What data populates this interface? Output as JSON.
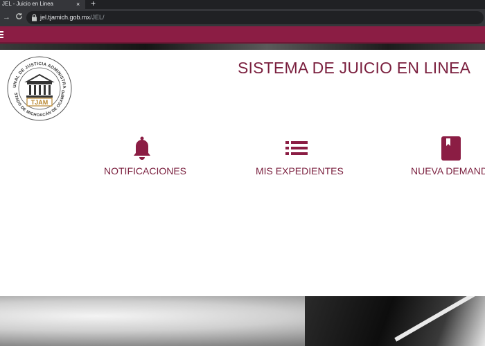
{
  "browser": {
    "tab_title": "JEL - Juicio en Linea",
    "tab_close": "×",
    "new_tab": "+",
    "back": "→",
    "reload": "C",
    "url_host": "jel.tjamich.gob.mx",
    "url_path": "/JEL/"
  },
  "logo": {
    "text_top": "TRIBUNAL DE JUSTICIA ADMINISTRATIVA",
    "text_bottom": "ESTADO DE MICHOACÁN DE OCAMPO",
    "abbr": "TJAM"
  },
  "page": {
    "title": "SISTEMA DE JUICIO EN LINEA"
  },
  "menu": [
    {
      "label": "NOTIFICACIONES",
      "icon": "bell-icon"
    },
    {
      "label": "MIS EXPEDIENTES",
      "icon": "list-icon"
    },
    {
      "label": "NUEVA DEMAND",
      "icon": "book-icon"
    }
  ],
  "colors": {
    "brand": "#8b1d44",
    "text_brand": "#7a1f3e",
    "gold": "#b8862e"
  }
}
